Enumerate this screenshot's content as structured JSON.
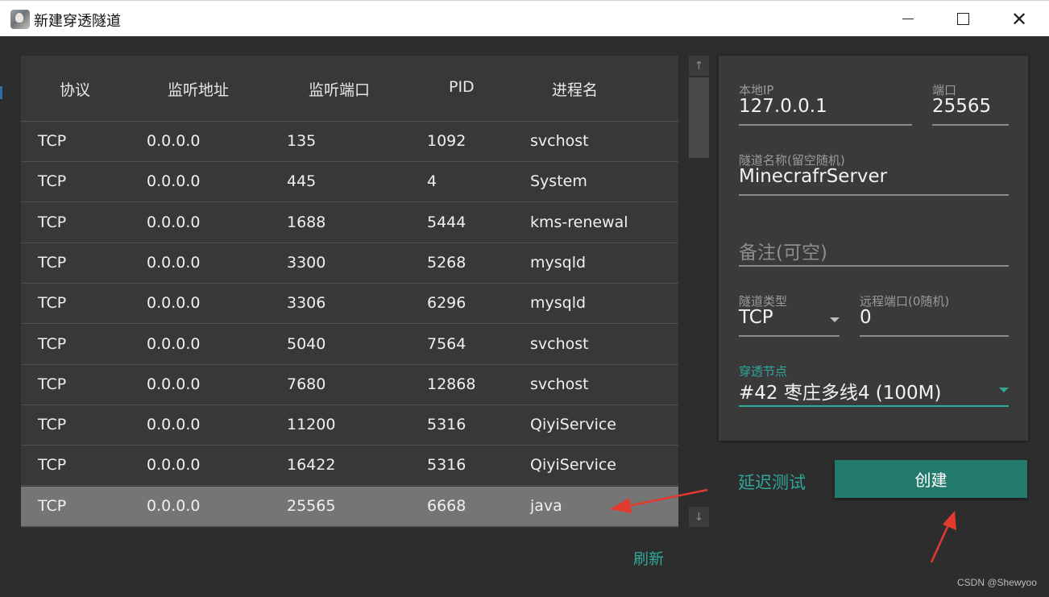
{
  "window": {
    "title": "新建穿透隧道",
    "minimize": "–",
    "maximize": "□",
    "close": "✕"
  },
  "table": {
    "headers": [
      "协议",
      "监听地址",
      "监听端口",
      "PID",
      "进程名"
    ],
    "rows": [
      [
        "TCP",
        "0.0.0.0",
        "135",
        "1092",
        "svchost"
      ],
      [
        "TCP",
        "0.0.0.0",
        "445",
        "4",
        "System"
      ],
      [
        "TCP",
        "0.0.0.0",
        "1688",
        "5444",
        "kms-renewal"
      ],
      [
        "TCP",
        "0.0.0.0",
        "3300",
        "5268",
        "mysqld"
      ],
      [
        "TCP",
        "0.0.0.0",
        "3306",
        "6296",
        "mysqld"
      ],
      [
        "TCP",
        "0.0.0.0",
        "5040",
        "7564",
        "svchost"
      ],
      [
        "TCP",
        "0.0.0.0",
        "7680",
        "12868",
        "svchost"
      ],
      [
        "TCP",
        "0.0.0.0",
        "11200",
        "5316",
        "QiyiService"
      ],
      [
        "TCP",
        "0.0.0.0",
        "16422",
        "5316",
        "QiyiService"
      ],
      [
        "TCP",
        "0.0.0.0",
        "25565",
        "6668",
        "java"
      ]
    ],
    "selected_row": 9,
    "scroll_up": "↑",
    "scroll_down": "↓",
    "refresh_label": "刷新"
  },
  "form": {
    "local_ip": {
      "label": "本地IP",
      "value": "127.0.0.1"
    },
    "port": {
      "label": "端口",
      "value": "25565"
    },
    "tunnel_name": {
      "label": "隧道名称(留空随机)",
      "value": "MinecrafrServer"
    },
    "remark": {
      "placeholder": "备注(可空)"
    },
    "tunnel_type": {
      "label": "隧道类型",
      "value": "TCP"
    },
    "remote_port": {
      "label": "远程端口(0随机)",
      "value": "0"
    },
    "node": {
      "label": "穿透节点",
      "value": "#42 枣庄多线4 (100M)"
    }
  },
  "actions": {
    "latency_test": "延迟测试",
    "create": "创建"
  },
  "watermark": "CSDN @Shewyoo",
  "colors": {
    "accent": "#2fa79a",
    "button": "#227a6c",
    "annotation_arrow": "#e23a2e"
  }
}
